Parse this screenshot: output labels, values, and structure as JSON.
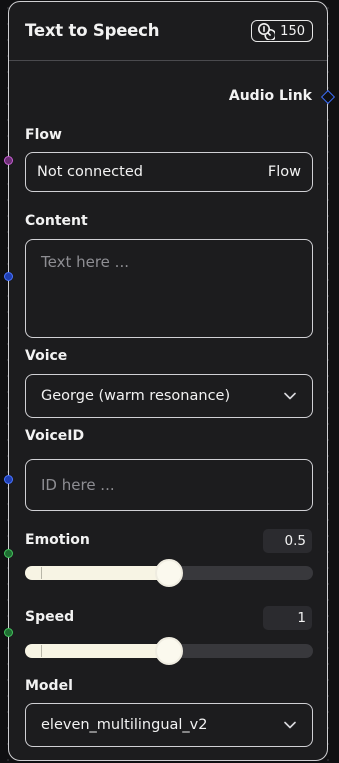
{
  "node": {
    "title": "Text to Speech",
    "credits": "150",
    "credits_icon": "coins-icon"
  },
  "output": {
    "label": "Audio Link",
    "handle_color": "#3b6cf6"
  },
  "flow": {
    "label": "Flow",
    "value": "Not connected",
    "type": "Flow",
    "handle_color": "#c65fd3"
  },
  "content": {
    "label": "Content",
    "placeholder": "Text here ...",
    "handle_color": "#4a74ff"
  },
  "voice": {
    "label": "Voice",
    "selected": "George (warm resonance)"
  },
  "voice_id": {
    "label": "VoiceID",
    "placeholder": "ID here ...",
    "handle_color": "#4a74ff"
  },
  "emotion": {
    "label": "Emotion",
    "value": "0.5",
    "level": 0.5,
    "handle_color": "#43c45e"
  },
  "speed": {
    "label": "Speed",
    "value": "1",
    "level": 0.5,
    "handle_color": "#43c45e"
  },
  "model": {
    "label": "Model",
    "selected": "eleven_multilingual_v2"
  },
  "colors": {
    "node_bg": "#1c1c1e",
    "slider_fill": "#f7f4e4",
    "text": "#f2f2f2",
    "placeholder": "#8e8e93"
  }
}
